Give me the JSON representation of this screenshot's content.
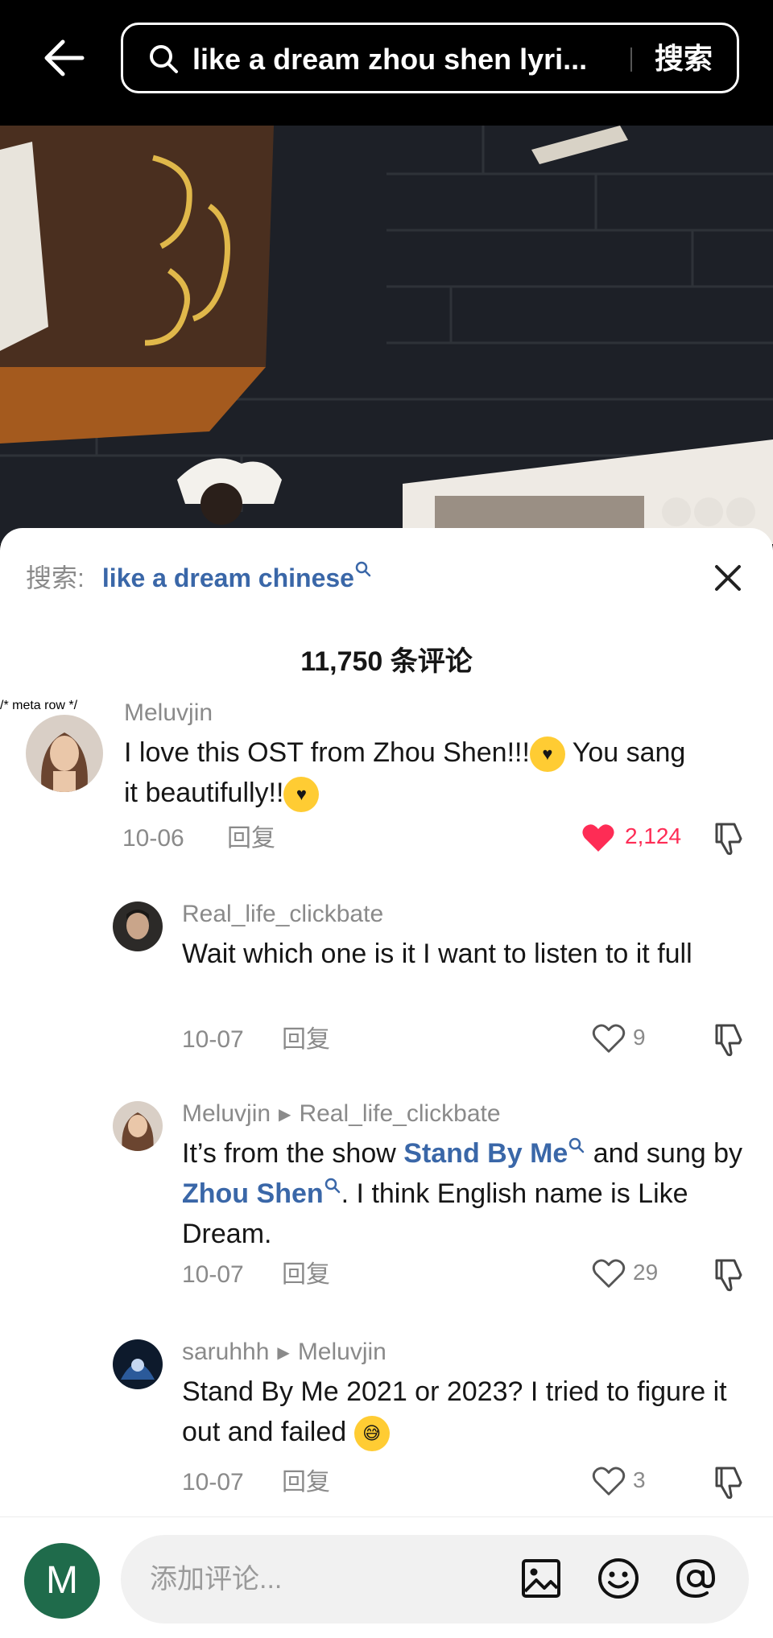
{
  "topbar": {
    "search_query": "like a dream zhou shen lyri...",
    "search_button": "搜索"
  },
  "related_search": {
    "label": "搜索:",
    "keyword": "like a dream chinese"
  },
  "comments_count": "11,750 条评论",
  "comments": [
    {
      "username": "Meluvjin",
      "text_parts": [
        "I love this OST from Zhou Shen!!!",
        " You sang it beautifully!!"
      ],
      "date": "10-06",
      "reply": "回复",
      "likes": "2,124",
      "liked": true
    },
    {
      "username": "Real_life_clickbate",
      "text": "Wait which one is it I want to listen to it full",
      "date": "10-07",
      "reply": "回复",
      "likes": "9"
    },
    {
      "username": "Meluvjin",
      "reply_to": "Real_life_clickbate",
      "text_a": "It’s from the show ",
      "link_a": "Stand By Me",
      "text_b": " and sung by ",
      "link_b": "Zhou Shen",
      "text_c": ". I think English name is Like Dream.",
      "date": "10-07",
      "reply": "回复",
      "likes": "29"
    },
    {
      "username": "saruhhh",
      "reply_to": "Meluvjin",
      "text": "Stand By Me 2021 or 2023? I tried to figure it out and failed",
      "date": "10-07",
      "reply": "回复",
      "likes": "3"
    }
  ],
  "bottom": {
    "avatar_letter": "M",
    "placeholder": "添加评论..."
  },
  "icons": [
    "back-arrow-icon",
    "search-icon",
    "close-icon",
    "heart-icon",
    "dislike-icon",
    "image-icon",
    "emoji-icon",
    "mention-icon"
  ],
  "colors": {
    "link": "#3a67a8",
    "like_red": "#fe2c55",
    "avatar_green": "#1f6b4b"
  }
}
